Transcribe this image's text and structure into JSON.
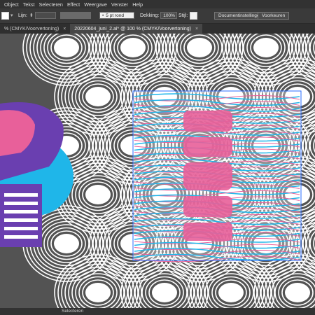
{
  "menubar": {
    "items": [
      "Object",
      "Tekst",
      "Selecteren",
      "Effect",
      "Weergave",
      "Venster",
      "Help"
    ]
  },
  "control_bar": {
    "stroke_label": "Lijn:",
    "brush_value": "5 pt rond",
    "opacity_label": "Dekking:",
    "opacity_value": "100%",
    "style_label": "Stijl:",
    "doc_settings_button": "Documentinstellingen",
    "preferences_button": "Voorkeuren"
  },
  "tabs": [
    {
      "label": "% (CMYK/Voorvertoning)",
      "active": false
    },
    {
      "label": "20220604_juni_2.ai* @ 100 % (CMYK/Voorvertoning)",
      "active": true
    }
  ],
  "status_bar": {
    "tool_label": "Selecteren"
  },
  "colors": {
    "cyan": "#1fb6e9",
    "magenta": "#e8609a",
    "purple": "#6a3fb0",
    "artboard": "#ffffff",
    "selection": "#2a6cff"
  },
  "icons": [
    "close-icon",
    "chevron-updown-icon",
    "dropdown-icon"
  ]
}
